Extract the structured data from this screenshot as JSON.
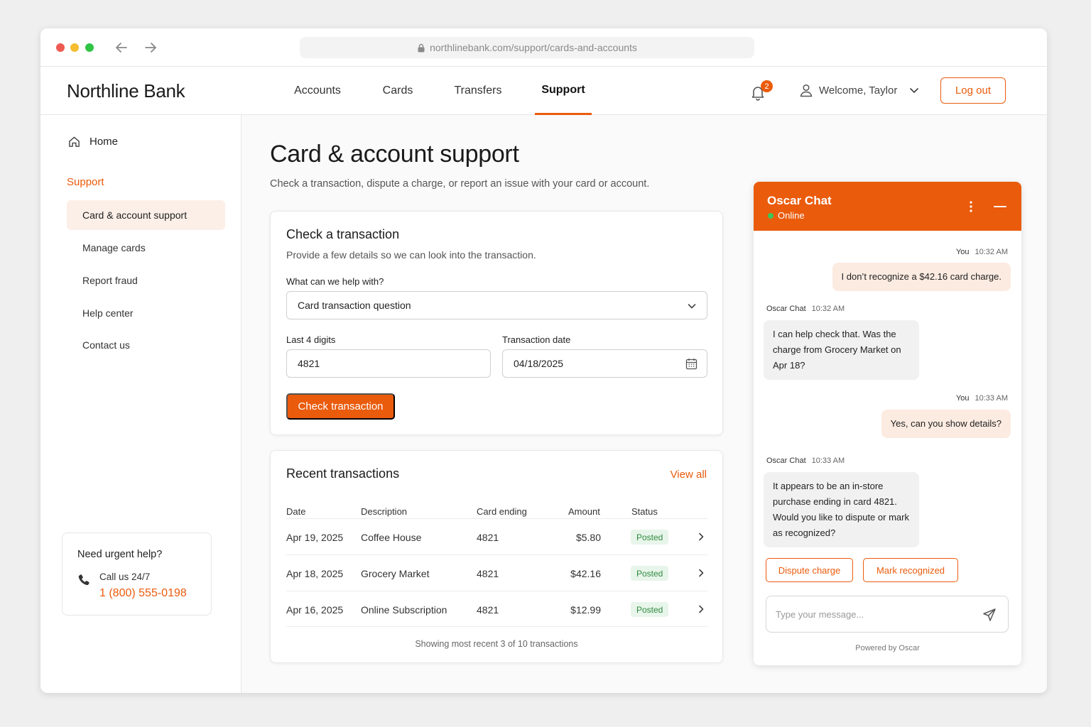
{
  "browser": {
    "url": "northlinebank.com/support/cards-and-accounts"
  },
  "brand": "Northline Bank",
  "nav": [
    {
      "label": "Accounts",
      "active": false
    },
    {
      "label": "Cards",
      "active": false
    },
    {
      "label": "Transfers",
      "active": false
    },
    {
      "label": "Support",
      "active": true
    }
  ],
  "header": {
    "notifications": "2",
    "welcome": "Welcome, Taylor",
    "logout": "Log out"
  },
  "sidebar": {
    "home": "Home",
    "section": "Support",
    "items": [
      {
        "label": "Card & account support",
        "active": true
      },
      {
        "label": "Manage cards",
        "active": false
      },
      {
        "label": "Report fraud",
        "active": false
      },
      {
        "label": "Help center",
        "active": false
      },
      {
        "label": "Contact us",
        "active": false
      }
    ],
    "urgent": {
      "title": "Need urgent help?",
      "call": "Call us 24/7",
      "phone": "1 (800) 555-0198"
    }
  },
  "page": {
    "title": "Card & account support",
    "subtitle": "Check a transaction, dispute a charge, or report an issue with your card or account."
  },
  "check": {
    "title": "Check a transaction",
    "desc": "Provide a few details so we can look into the transaction.",
    "help_label": "What can we help with?",
    "help_value": "Card transaction question",
    "digits_label": "Last 4 digits",
    "digits_value": "4821",
    "date_label": "Transaction date",
    "date_value": "04/18/2025",
    "button": "Check transaction"
  },
  "transactions": {
    "title": "Recent transactions",
    "view_all": "View all",
    "columns": [
      "Date",
      "Description",
      "Card ending",
      "Amount",
      "Status"
    ],
    "rows": [
      {
        "date": "Apr 19, 2025",
        "desc": "Coffee House",
        "card": "4821",
        "amount": "$5.80",
        "status": "Posted"
      },
      {
        "date": "Apr 18, 2025",
        "desc": "Grocery Market",
        "card": "4821",
        "amount": "$42.16",
        "status": "Posted"
      },
      {
        "date": "Apr 16, 2025",
        "desc": "Online Subscription",
        "card": "4821",
        "amount": "$12.99",
        "status": "Posted"
      }
    ],
    "footer": "Showing most recent 3 of 10 transactions"
  },
  "chat": {
    "title": "Oscar Chat",
    "status": "Online",
    "messages": [
      {
        "sender": "You",
        "time": "10:32 AM",
        "text": "I don’t recognize a $42.16 card charge."
      },
      {
        "sender": "Oscar Chat",
        "time": "10:32 AM",
        "text": "I can help check that. Was the charge from Grocery Market on Apr 18?"
      },
      {
        "sender": "You",
        "time": "10:33 AM",
        "text": "Yes, can you show details?"
      },
      {
        "sender": "Oscar Chat",
        "time": "10:33 AM",
        "text": "It appears to be an in-store purchase ending in card 4821. Would you like to dispute or mark as recognized?"
      }
    ],
    "actions": [
      "Dispute charge",
      "Mark recognized"
    ],
    "input_placeholder": "Type your message...",
    "powered": "Powered by Oscar"
  },
  "colors": {
    "accent": "#ea5b0c",
    "online": "#3cc65a",
    "posted": "#2e8b3e"
  }
}
